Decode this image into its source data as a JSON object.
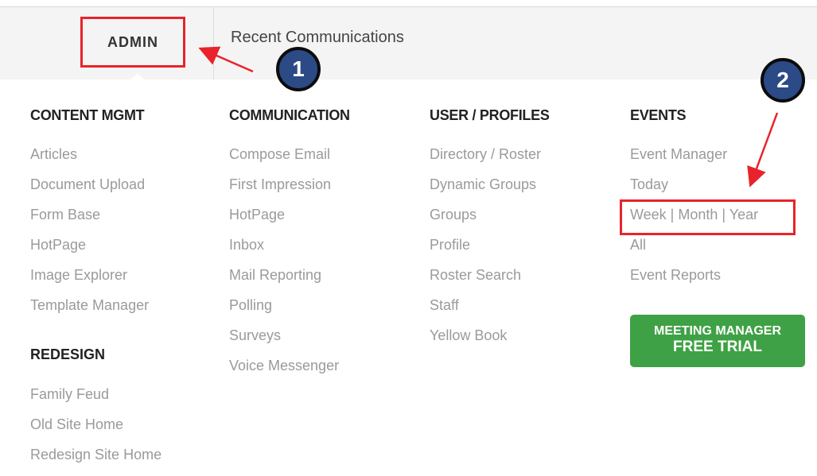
{
  "nav": {
    "admin_label": "ADMIN",
    "recent_label": "Recent Communications"
  },
  "columns": [
    {
      "heading": "CONTENT MGMT",
      "items": [
        "Articles",
        "Document Upload",
        "Form Base",
        "HotPage",
        "Image Explorer",
        "Template Manager"
      ]
    },
    {
      "heading": "COMMUNICATION",
      "items": [
        "Compose Email",
        "First Impression",
        "HotPage",
        "Inbox",
        "Mail Reporting",
        "Polling",
        "Surveys",
        "Voice Messenger"
      ]
    },
    {
      "heading": "USER / PROFILES",
      "items": [
        "Directory / Roster",
        "Dynamic Groups",
        "Groups",
        "Profile",
        "Roster Search",
        "Staff",
        "Yellow Book"
      ]
    },
    {
      "heading": "EVENTS",
      "items": [
        "Event Manager",
        "Today",
        "Week | Month | Year",
        "All",
        "Event Reports"
      ]
    }
  ],
  "redesign": {
    "heading": "REDESIGN",
    "items": [
      "Family Feud",
      "Old Site Home",
      "Redesign Site Home"
    ]
  },
  "cta": {
    "line1": "MEETING MANAGER",
    "line2": "FREE TRIAL"
  },
  "callouts": [
    "1",
    "2"
  ],
  "colors": {
    "highlight": "#e8232b",
    "badge": "#2b4a86",
    "cta": "#3fa145"
  }
}
